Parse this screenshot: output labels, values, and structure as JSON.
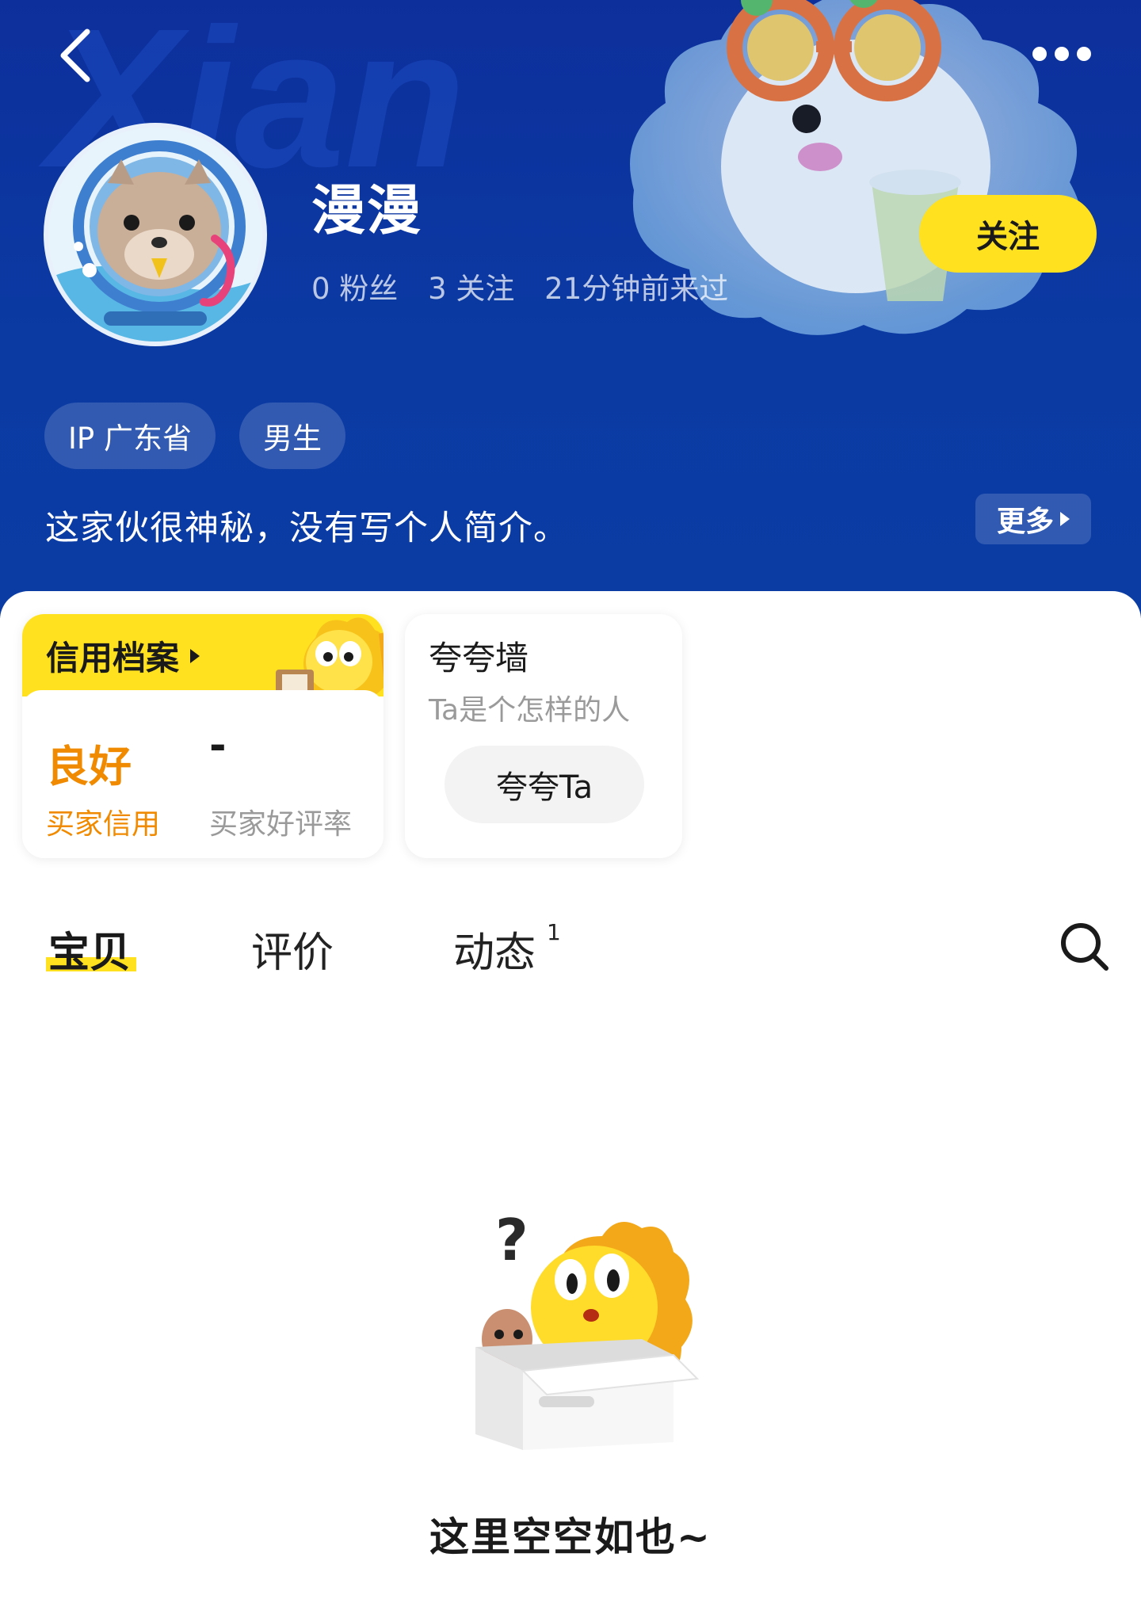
{
  "profile": {
    "username": "漫漫",
    "fans": "0 粉丝",
    "following": "3 关注",
    "last_seen": "21分钟前来过",
    "follow_label": "关注"
  },
  "tags": {
    "ip": "IP 广东省",
    "gender": "男生"
  },
  "bio": {
    "text": "这家伙很神秘，没有写个人简介。",
    "more_label": "更多"
  },
  "credit": {
    "title": "信用档案",
    "level": "良好",
    "level_label": "买家信用",
    "rate": "-",
    "rate_label": "买家好评率"
  },
  "praise": {
    "title": "夸夸墙",
    "subtitle": "Ta是个怎样的人",
    "button_label": "夸夸Ta"
  },
  "tabs": {
    "goods": "宝贝",
    "reviews": "评价",
    "moments": "动态",
    "moments_badge": "1"
  },
  "empty": {
    "text": "这里空空如也~"
  },
  "icons": {
    "back": "chevron-left-icon",
    "more": "more-dots-icon",
    "search": "search-icon"
  },
  "colors": {
    "header_bg": "#0b3aa3",
    "accent_yellow": "#ffe11f",
    "credit_orange": "#f08a00",
    "muted_text": "#9a9a9a"
  }
}
